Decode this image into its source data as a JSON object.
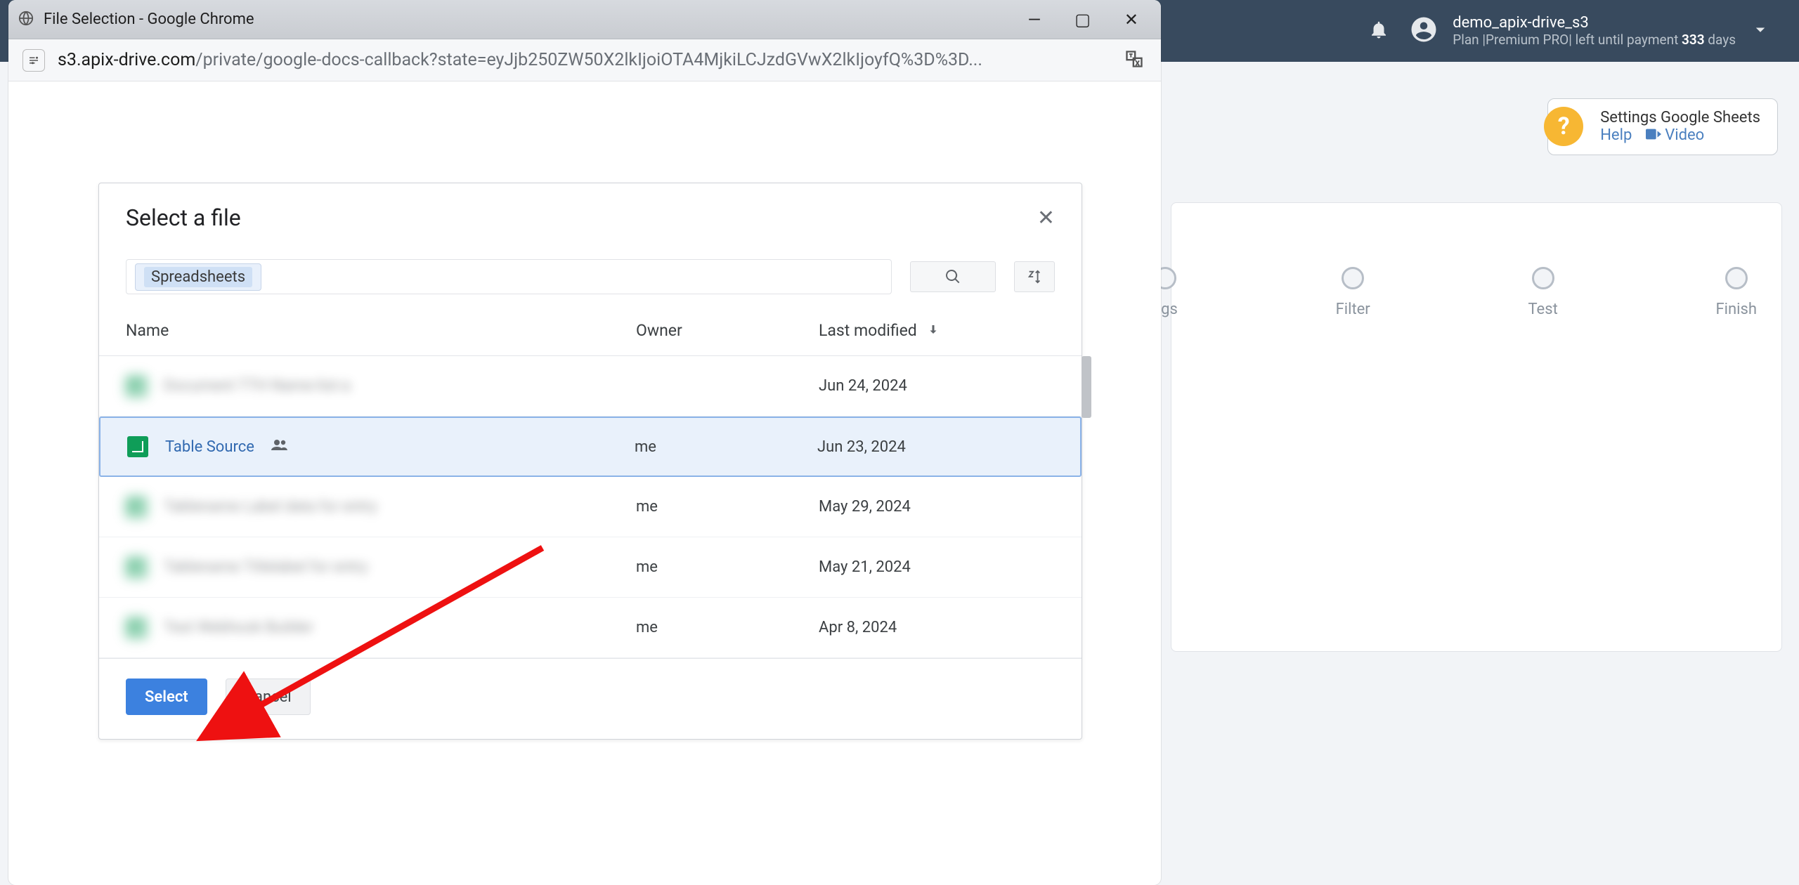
{
  "topbar": {
    "username": "demo_apix-drive_s3",
    "plan_prefix": "Plan |",
    "plan_name": "Premium PRO",
    "plan_mid": "| left until payment ",
    "plan_days": "333",
    "plan_suffix": " days"
  },
  "help": {
    "title": "Settings Google Sheets",
    "help": "Help",
    "video": "Video"
  },
  "steps": {
    "settings": "ngs",
    "filter": "Filter",
    "test": "Test",
    "finish": "Finish"
  },
  "popup": {
    "title": "File Selection - Google Chrome",
    "url_host": "s3.apix-drive.com",
    "url_path": "/private/google-docs-callback?state=eyJjb250ZW50X2lkIjoiOTA4MjkiLCJzdGVwX2lkIjoyfQ%3D%3D..."
  },
  "picker": {
    "title": "Select a file",
    "filter_label": "Spreadsheets",
    "columns": {
      "name": "Name",
      "owner": "Owner",
      "modified": "Last modified"
    },
    "rows": [
      {
        "name": "Document TTH Name-list-a",
        "owner": "",
        "modified": "Jun 24, 2024",
        "blurred": true
      },
      {
        "name": "Table Source",
        "owner": "me",
        "modified": "Jun 23, 2024",
        "selected": true,
        "shared": true
      },
      {
        "name": "Tablename Label data for entry",
        "owner": "me",
        "modified": "May 29, 2024",
        "blurred": true
      },
      {
        "name": "Tablename Titlelabel for entry",
        "owner": "me",
        "modified": "May 21, 2024",
        "blurred": true
      },
      {
        "name": "Test Webhook Builder",
        "owner": "me",
        "modified": "Apr 8, 2024",
        "blurred": true
      }
    ],
    "select": "Select",
    "cancel": "Cancel"
  }
}
